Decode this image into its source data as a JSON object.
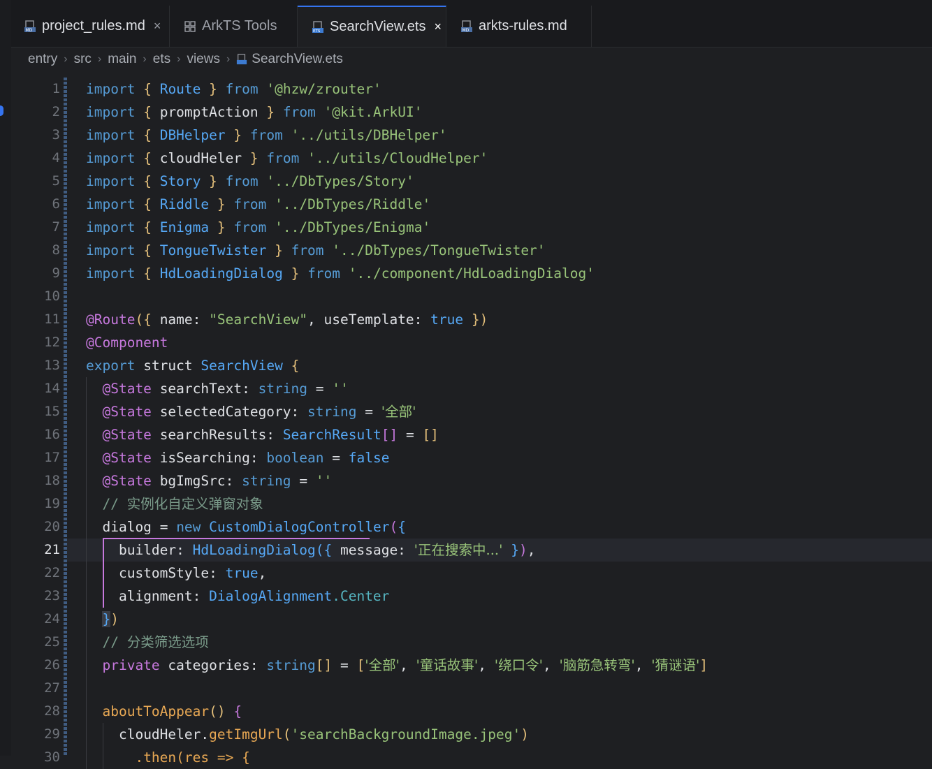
{
  "tabs": [
    {
      "label": "project_rules.md",
      "icon": "markdown-file-icon",
      "closable": true,
      "active": false
    },
    {
      "label": "ArkTS Tools",
      "icon": "grid-tool-icon",
      "closable": false,
      "active": false
    },
    {
      "label": "SearchView.ets",
      "icon": "ets-file-icon",
      "closable": true,
      "active": true
    },
    {
      "label": "arkts-rules.md",
      "icon": "markdown-file-icon",
      "closable": false,
      "active": false
    }
  ],
  "close_glyph": "×",
  "breadcrumb": [
    "entry",
    "src",
    "main",
    "ets",
    "views",
    "SearchView.ets"
  ],
  "current_line": 21,
  "colors": {
    "accent": "#3574f0",
    "background": "#1e1f22",
    "keyword": "#569cd6",
    "string": "#98c379"
  },
  "code": {
    "l1": [
      "import",
      "{",
      "Route",
      "}",
      "from",
      "'@hzw/zrouter'"
    ],
    "l2": [
      "import",
      "{",
      "promptAction",
      "}",
      "from",
      "'@kit.ArkUI'"
    ],
    "l3": [
      "import",
      "{",
      "DBHelper",
      "}",
      "from",
      "'../utils/DBHelper'"
    ],
    "l4": [
      "import",
      "{",
      "cloudHeler",
      "}",
      "from",
      "'../utils/CloudHelper'"
    ],
    "l5": [
      "import",
      "{",
      "Story",
      "}",
      "from",
      "'../DbTypes/Story'"
    ],
    "l6": [
      "import",
      "{",
      "Riddle",
      "}",
      "from",
      "'../DbTypes/Riddle'"
    ],
    "l7": [
      "import",
      "{",
      "Enigma",
      "}",
      "from",
      "'../DbTypes/Enigma'"
    ],
    "l8": [
      "import",
      "{",
      "TongueTwister",
      "}",
      "from",
      "'../DbTypes/TongueTwister'"
    ],
    "l9": [
      "import",
      "{",
      "HdLoadingDialog",
      "}",
      "from",
      "'../component/HdLoadingDialog'"
    ],
    "l11": [
      "@Route",
      "({",
      "name:",
      "\"SearchView\"",
      ",",
      "useTemplate:",
      "true",
      "})"
    ],
    "l12": [
      "@Component"
    ],
    "l13": [
      "export",
      "struct",
      "SearchView",
      "{"
    ],
    "l14": [
      "@State",
      "searchText:",
      "string",
      "=",
      "''"
    ],
    "l15": [
      "@State",
      "selectedCategory:",
      "string",
      "=",
      "'全部'"
    ],
    "l16": [
      "@State",
      "searchResults:",
      "SearchResult",
      "[]",
      "=",
      "[]"
    ],
    "l17": [
      "@State",
      "isSearching:",
      "boolean",
      "=",
      "false"
    ],
    "l18": [
      "@State",
      "bgImgSrc:",
      "string",
      "=",
      "''"
    ],
    "l19": [
      "//",
      "实例化自定义弹窗对象"
    ],
    "l20": [
      "dialog",
      "=",
      "new",
      "CustomDialogController",
      "(",
      "{"
    ],
    "l21": [
      "builder:",
      "HdLoadingDialog",
      "(",
      "{",
      "message:",
      "'正在搜索中...'",
      "}",
      ")",
      ","
    ],
    "l22": [
      "customStyle:",
      "true",
      ","
    ],
    "l23": [
      "alignment:",
      "DialogAlignment",
      ".Center"
    ],
    "l24": [
      "}",
      ")"
    ],
    "l25": [
      "//",
      "分类筛选选项"
    ],
    "l26": [
      "private",
      "categories:",
      "string",
      "[]",
      "=",
      "[",
      "'全部'",
      ",",
      "'童话故事'",
      ",",
      "'绕口令'",
      ",",
      "'脑筋急转弯'",
      ",",
      "'猜谜语'",
      "]"
    ],
    "l28": [
      "aboutToAppear",
      "()",
      "{"
    ],
    "l29": [
      "cloudHeler",
      ".",
      "getImgUrl",
      "(",
      "'searchBackgroundImage.jpeg'",
      ")"
    ],
    "l30": [
      ".then(res => {"
    ]
  },
  "line_numbers": [
    "1",
    "2",
    "3",
    "4",
    "5",
    "6",
    "7",
    "8",
    "9",
    "10",
    "11",
    "12",
    "13",
    "14",
    "15",
    "16",
    "17",
    "18",
    "19",
    "20",
    "21",
    "22",
    "23",
    "24",
    "25",
    "26",
    "27",
    "28",
    "29",
    "30"
  ]
}
